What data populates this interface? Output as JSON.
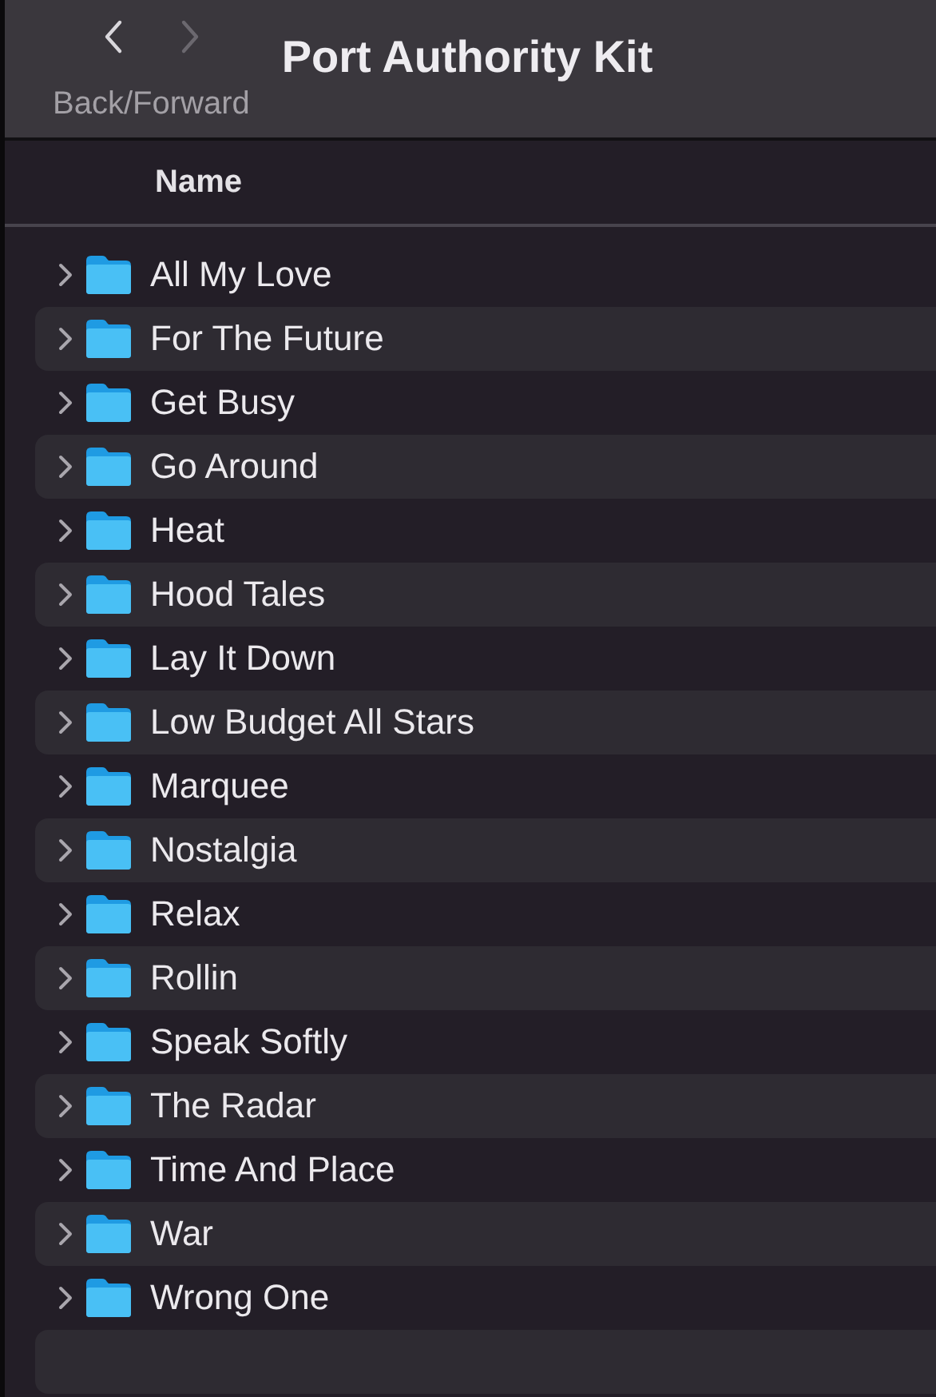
{
  "window": {
    "title": "Port Authority Kit"
  },
  "navigation": {
    "label": "Back/Forward",
    "back_disabled": false,
    "forward_disabled": true
  },
  "table": {
    "columns": [
      "Name"
    ],
    "rows": [
      {
        "name": "All My Love",
        "expanded": false
      },
      {
        "name": "For The Future",
        "expanded": false
      },
      {
        "name": "Get Busy",
        "expanded": false
      },
      {
        "name": "Go Around",
        "expanded": false
      },
      {
        "name": "Heat",
        "expanded": false
      },
      {
        "name": "Hood Tales",
        "expanded": false
      },
      {
        "name": "Lay It Down",
        "expanded": false
      },
      {
        "name": "Low Budget All Stars",
        "expanded": false
      },
      {
        "name": "Marquee",
        "expanded": false
      },
      {
        "name": "Nostalgia",
        "expanded": false
      },
      {
        "name": "Relax",
        "expanded": false
      },
      {
        "name": "Rollin",
        "expanded": false
      },
      {
        "name": "Speak Softly",
        "expanded": false
      },
      {
        "name": "The Radar",
        "expanded": false
      },
      {
        "name": "Time And Place",
        "expanded": false
      },
      {
        "name": "War",
        "expanded": false
      },
      {
        "name": "Wrong One",
        "expanded": false
      }
    ]
  }
}
